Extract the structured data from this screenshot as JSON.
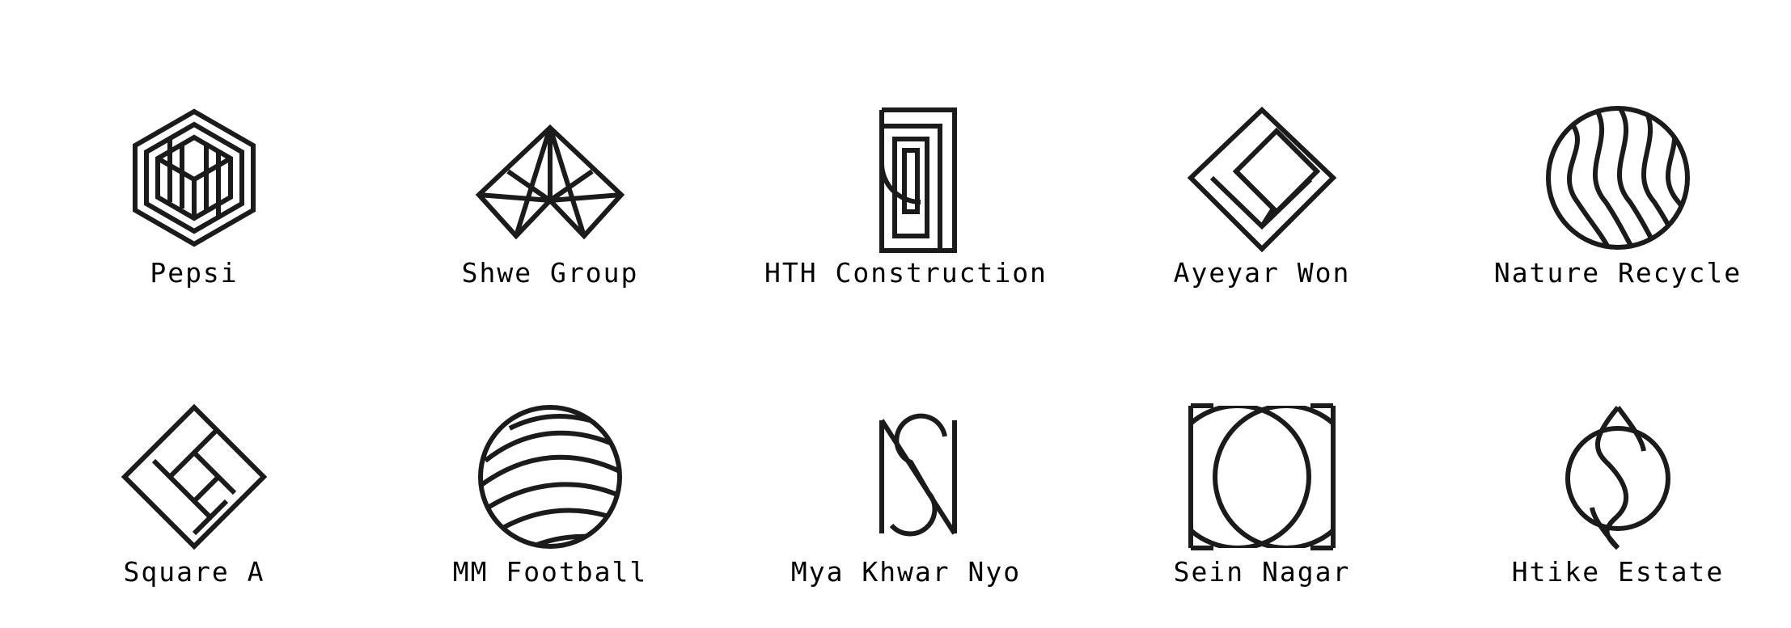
{
  "logos": [
    {
      "name": "Pepsi",
      "icon": "isometric-cube-icon"
    },
    {
      "name": "Shwe Group",
      "icon": "faceted-diamond-icon"
    },
    {
      "name": "HTH Construction",
      "icon": "nested-rectangles-icon"
    },
    {
      "name": "Ayeyar Won",
      "icon": "nested-diamond-icon"
    },
    {
      "name": "Nature Recycle",
      "icon": "wave-circle-icon"
    },
    {
      "name": "Square A",
      "icon": "spiral-diamond-icon"
    },
    {
      "name": "MM Football",
      "icon": "striped-ball-icon"
    },
    {
      "name": "Mya Khwar Nyo",
      "icon": "ns-monogram-icon"
    },
    {
      "name": "Sein Nagar",
      "icon": "overlapping-circles-icon"
    },
    {
      "name": "Htike Estate",
      "icon": "circle-leaf-icon"
    }
  ],
  "colors": {
    "ink": "#1b1b1b",
    "background": "#ffffff"
  }
}
